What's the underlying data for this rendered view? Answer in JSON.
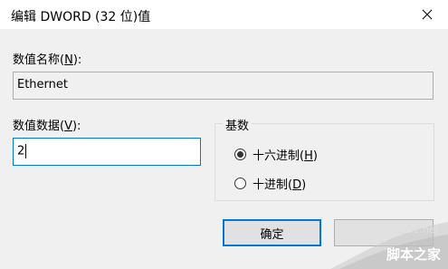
{
  "window": {
    "title": "编辑 DWORD (32 位)值"
  },
  "value_name": {
    "label_prefix": "数值名称(",
    "accel": "N",
    "label_suffix": "):",
    "value": "Ethernet"
  },
  "value_data": {
    "label_prefix": "数值数据(",
    "accel": "V",
    "label_suffix": "):",
    "value": "2"
  },
  "base": {
    "title": "基数",
    "options": [
      {
        "prefix": "十六进制(",
        "accel": "H",
        "suffix": ")",
        "checked": true
      },
      {
        "prefix": "十进制(",
        "accel": "D",
        "suffix": ")",
        "checked": false
      }
    ]
  },
  "buttons": {
    "ok": "确定",
    "cancel": ""
  },
  "watermark": {
    "site": "jb51.net",
    "brand": "脚本之家"
  },
  "colors": {
    "accent": "#0078d7",
    "background": "#f0f0f0"
  }
}
